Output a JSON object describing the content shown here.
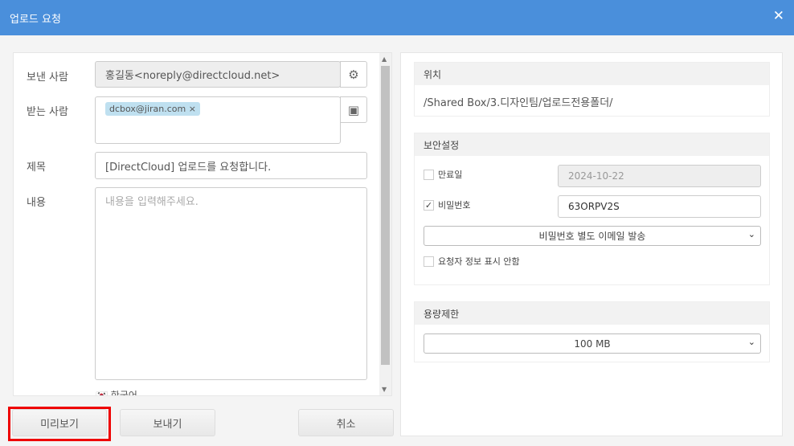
{
  "title": "업로드 요청",
  "form": {
    "sender_label": "보낸 사람",
    "sender_value": "홍길동<noreply@directcloud.net>",
    "recipient_label": "받는 사람",
    "recipients": [
      "dcbox@jiran.com"
    ],
    "subject_label": "제목",
    "subject_value": "[DirectCloud] 업로드를 요청합니다.",
    "content_label": "내용",
    "content_placeholder": "내용을 입력해주세요.",
    "language": "한국어"
  },
  "buttons": {
    "preview": "미리보기",
    "send": "보내기",
    "cancel": "취소"
  },
  "location": {
    "header": "위치",
    "path": "/Shared Box/3.디자인팀/업로드전용폴더/"
  },
  "security": {
    "header": "보안설정",
    "expiry_label": "만료일",
    "expiry_checked": false,
    "expiry_value": "2024-10-22",
    "password_label": "비밀번호",
    "password_checked": true,
    "password_value": "63ORPV2S",
    "password_delivery": "비밀번호 별도 이메일 발송",
    "hide_requester_label": "요청자 정보 표시 안함",
    "hide_requester_checked": false
  },
  "capacity": {
    "header": "용량제한",
    "value": "100 MB"
  },
  "colors": {
    "titlebar": "#4a8fdb",
    "highlight": "#ee0000",
    "chip": "#bfe0f0"
  }
}
